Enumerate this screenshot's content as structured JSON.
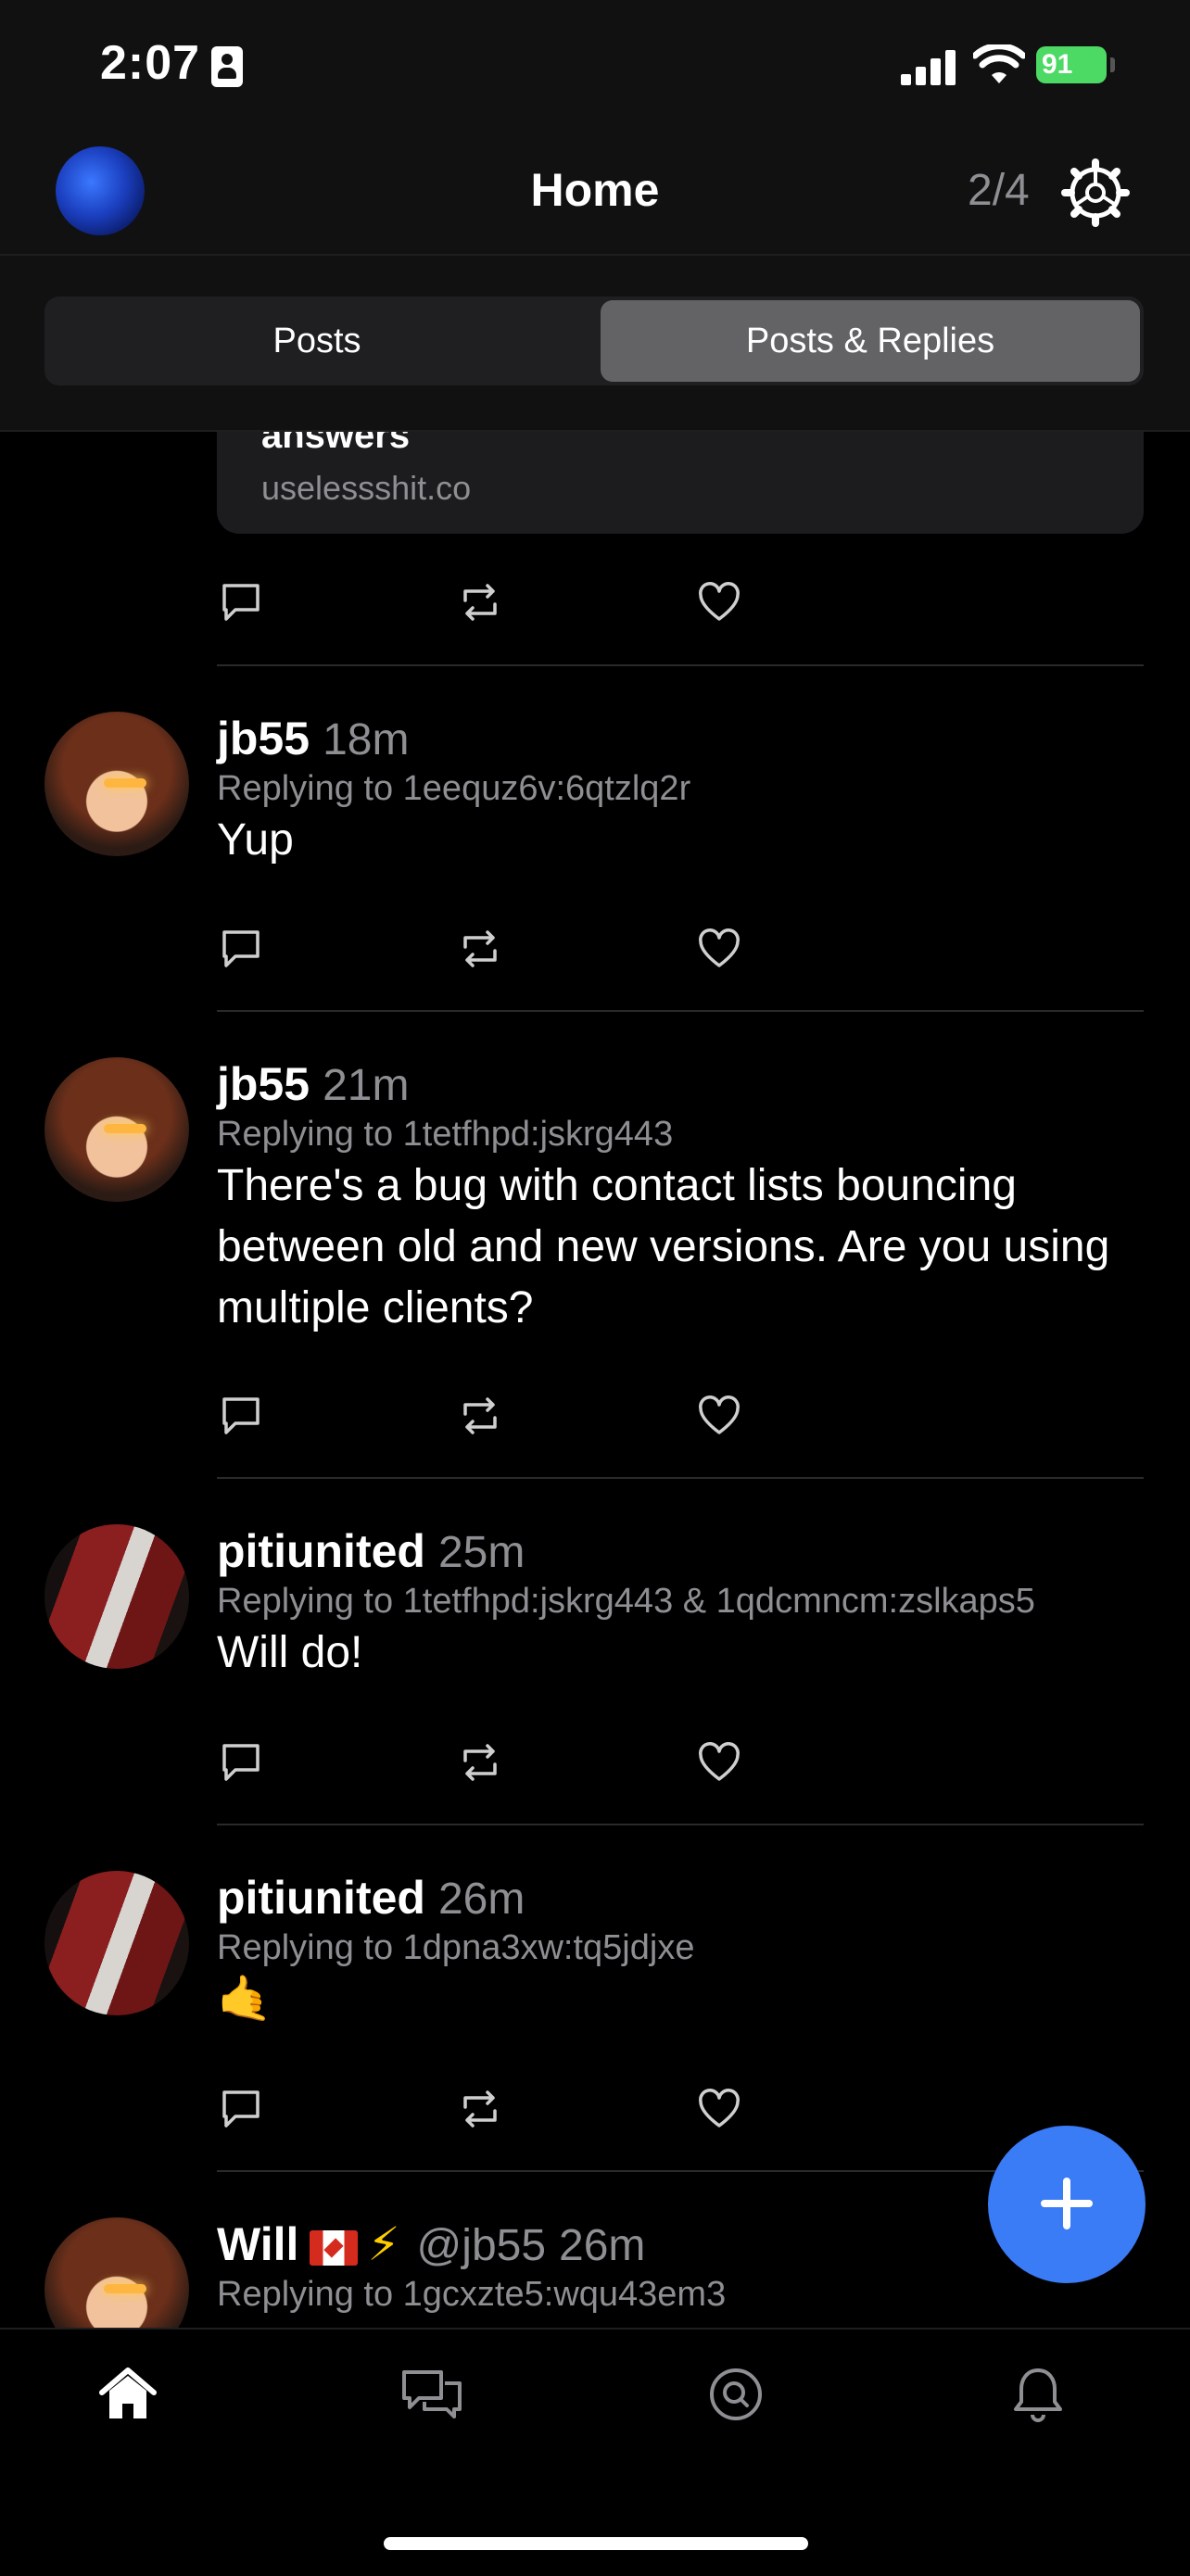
{
  "status_bar": {
    "time": "2:07",
    "battery": "91"
  },
  "header": {
    "title": "Home",
    "page_counter": "2/4"
  },
  "segments": {
    "posts": "Posts",
    "posts_replies": "Posts & Replies",
    "selected": "Posts & Replies"
  },
  "preview": {
    "title": "answers",
    "url": "uselessshit.co"
  },
  "posts": [
    {
      "name": "jb55",
      "age": "18m",
      "replying": "Replying to 1eequz6v:6qtzlq2r",
      "body": "Yup"
    },
    {
      "name": "jb55",
      "age": "21m",
      "replying": "Replying to 1tetfhpd:jskrg443",
      "body": "There's a bug with contact lists bouncing between old and new versions. Are you using multiple clients?"
    },
    {
      "name": "pitiunited",
      "age": "25m",
      "replying": "Replying to 1tetfhpd:jskrg443 & 1qdcmncm:zslkaps5",
      "body": "Will do!"
    },
    {
      "name": "pitiunited",
      "age": "26m",
      "replying": "Replying to 1dpna3xw:tq5jdjxe",
      "body": "🤙"
    },
    {
      "name": "Will",
      "handle": "@jb55",
      "age": "26m",
      "replying": "Replying to 1gcxzte5:wqu43em3",
      "emoji": "⚡"
    }
  ],
  "icons": {
    "reply": "reply-icon",
    "repost": "repost-icon",
    "like": "heart-icon",
    "settings": "gear-icon",
    "compose": "plus-icon",
    "tabs": [
      "home-icon",
      "messages-icon",
      "search-icon",
      "bell-icon"
    ]
  },
  "colors": {
    "accent": "#3a7bf6",
    "background": "#000000",
    "secondary_text": "#8e8e93",
    "battery": "#4cd964"
  }
}
